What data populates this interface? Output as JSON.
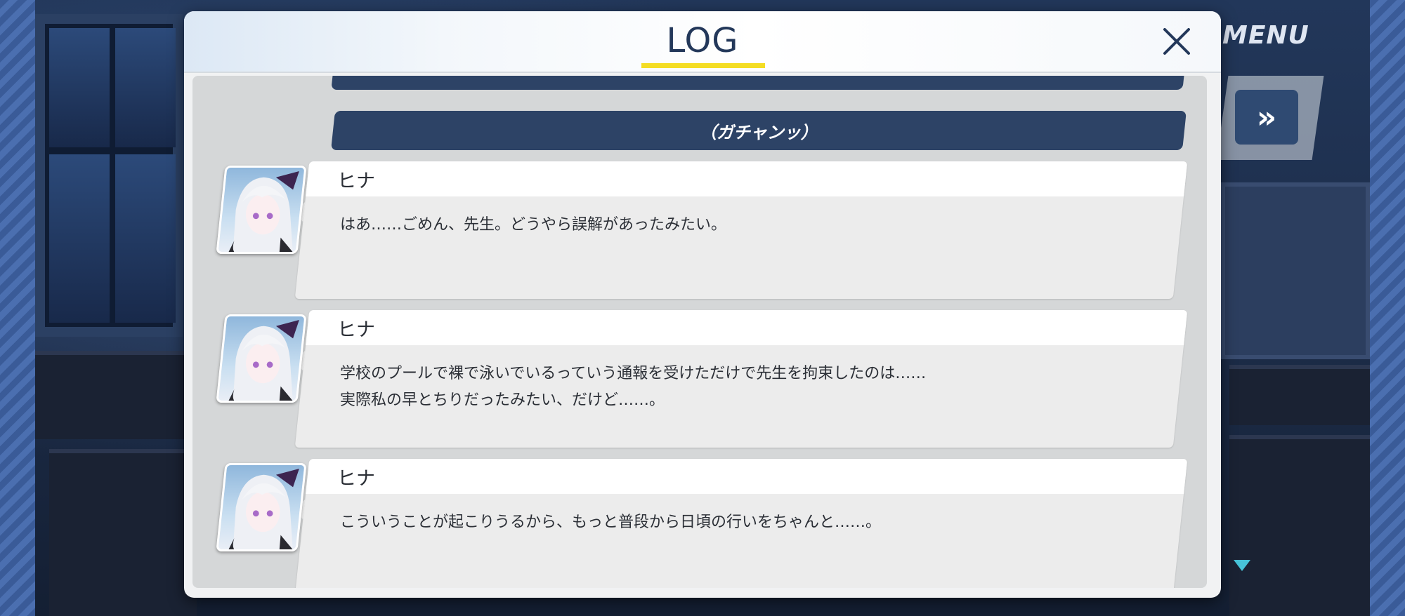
{
  "dialog": {
    "title": "LOG",
    "close_icon": "close-icon"
  },
  "hud": {
    "menu_label": "MENU",
    "fast_forward_icon": "fast-forward-icon",
    "fast_forward_glyph": "»",
    "scroll_indicator_icon": "scroll-down-icon"
  },
  "log": {
    "system_line": "（ガチャンッ）",
    "entries": [
      {
        "speaker": "ヒナ",
        "avatar_icon": "character-portrait",
        "lines": [
          "はあ……ごめん、先生。どうやら誤解があったみたい。"
        ]
      },
      {
        "speaker": "ヒナ",
        "avatar_icon": "character-portrait",
        "lines": [
          "学校のプールで裸で泳いでいるっていう通報を受けただけで先生を拘束したのは……",
          "実際私の早とちりだったみたい、だけど……。"
        ]
      },
      {
        "speaker": "ヒナ",
        "avatar_icon": "character-portrait",
        "lines": [
          "こういうことが起こりうるから、もっと普段から日頃の行いをちゃんと……。"
        ]
      }
    ]
  },
  "colors": {
    "accent_underline": "#f4dd24",
    "system_bar": "#2d4366",
    "title_text": "#23385a",
    "scroll_indicator": "#47c3d8"
  }
}
